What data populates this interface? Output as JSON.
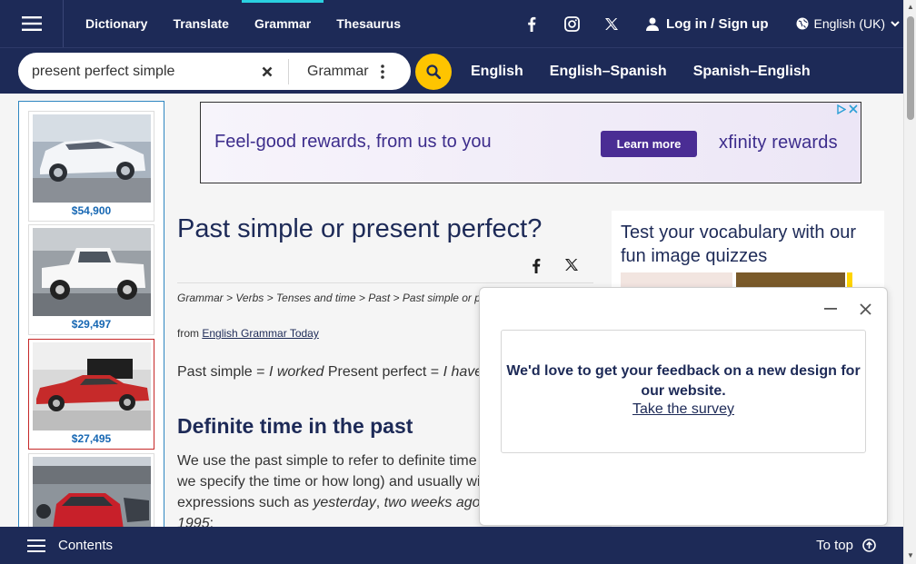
{
  "topnav": {
    "links": [
      "Dictionary",
      "Translate",
      "Grammar",
      "Thesaurus"
    ],
    "active_index": 2,
    "login": "Log in / Sign up",
    "language": "English (UK)",
    "social_icons": [
      "facebook-icon",
      "instagram-icon",
      "x-icon"
    ]
  },
  "search": {
    "value": "present perfect simple",
    "dictionary": "Grammar",
    "links": [
      "English",
      "English–Spanish",
      "Spanish–English"
    ]
  },
  "left_ad": {
    "prices": [
      "$54,900",
      "$29,497",
      "$27,495"
    ]
  },
  "banner_ad": {
    "text": "Feel-good rewards, from us to you",
    "cta": "Learn more",
    "brand": "xfinity rewards"
  },
  "article": {
    "title": "Past simple or present perfect?",
    "breadcrumb": "Grammar > Verbs > Tenses and time > Past > Past simple or p",
    "from_label": "from ",
    "from_link": "English Grammar Today",
    "example_label1": "Past simple = ",
    "example_val1": "I worked",
    "example_label2": " Present perfect = ",
    "example_val2": "I have",
    "section_title": "Definite time in the past",
    "para_1": "We use the past simple to refer to definite time",
    "para_2": "we specify the time or how long) and usually wi",
    "para_3": "expressions such as ",
    "para_i1": "yesterday",
    "para_4": ", ",
    "para_i2": "two weeks ago",
    "para_i3": "1995",
    "para_5": ":"
  },
  "quiz": {
    "title": "Test your vocabulary with our fun image quizzes"
  },
  "feedback": {
    "message": "We'd love to get your feedback on a new design for our website.",
    "link": "Take the survey"
  },
  "bottombar": {
    "contents": "Contents",
    "to_top": "To top"
  },
  "colors": {
    "navy": "#1d2a57",
    "accent_yellow": "#fec400",
    "active_tab": "#2ad0e0"
  }
}
